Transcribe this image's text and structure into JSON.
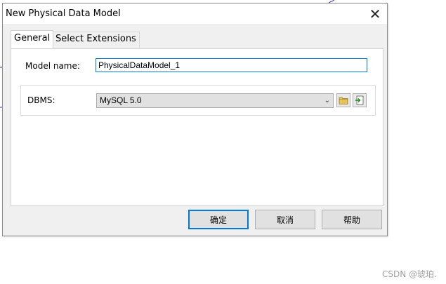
{
  "dialog": {
    "title": "New Physical Data Model",
    "close_glyph": "✕",
    "tabs": [
      {
        "label": "General"
      },
      {
        "label": "Select Extensions"
      }
    ],
    "model_name": {
      "label": "Model name:",
      "value": "PhysicalDataModel_1"
    },
    "dbms": {
      "label": "DBMS:",
      "selected": "MySQL 5.0"
    },
    "icons": {
      "browse": "folder-icon",
      "embed": "import-file-icon"
    },
    "buttons": {
      "ok": "确定",
      "cancel": "取消",
      "help": "帮助"
    }
  },
  "watermark": "CSDN @琥珀.",
  "colors": {
    "accent": "#0078d7",
    "dialog_bg": "#f0f0f0",
    "button_bg": "#e1e1e1"
  }
}
